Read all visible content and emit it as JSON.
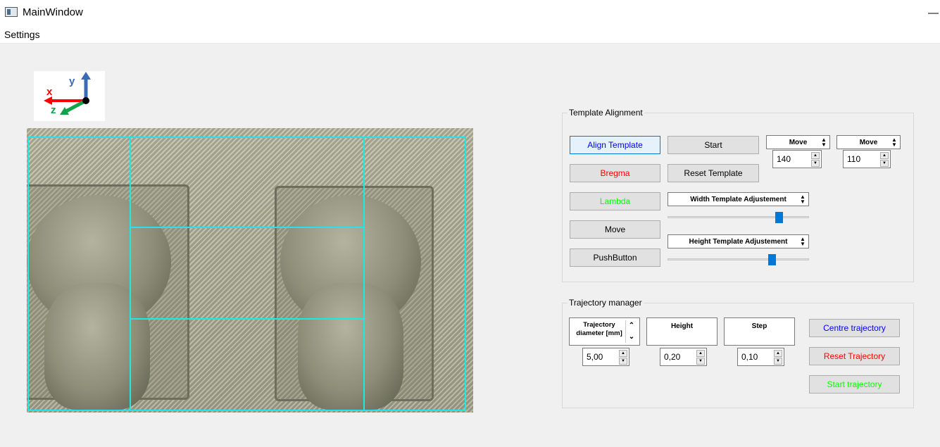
{
  "window": {
    "title": "MainWindow",
    "minimize_glyph": "—"
  },
  "menu": {
    "settings": "Settings"
  },
  "axes": {
    "x": "x",
    "y": "y",
    "z": "z"
  },
  "template_alignment": {
    "title": "Template Alignment",
    "align_template": "Align Template",
    "bregma": "Bregma",
    "lambda": "Lambda",
    "move": "Move",
    "push_button": "PushButton",
    "start": "Start",
    "reset_template": "Reset Template",
    "move_combo_1": "Move",
    "move_value_1": "140",
    "move_combo_2": "Move",
    "move_value_2": "110",
    "width_adjustment": "Width Template Adjustement",
    "height_adjustment": "Height Template Adjustement"
  },
  "trajectory_manager": {
    "title": "Trajectory manager",
    "diameter_label": "Trajectory diameter [mm]",
    "diameter_value": "5,00",
    "height_label": "Height",
    "height_value": "0,20",
    "step_label": "Step",
    "step_value": "0,10",
    "centre_trajectory": "Centre trajectory",
    "reset_trajectory": "Reset Trajectory",
    "start_trajectory": "Start trajectory"
  },
  "colors": {
    "blue_text": "#0000ff",
    "red_text": "#ff0000",
    "green_text": "#00ff00",
    "overlay_cyan": "#22e5e5",
    "slider_handle": "#0078d7"
  },
  "sliders": {
    "width_level_percent": 79,
    "height_level_percent": 73
  }
}
